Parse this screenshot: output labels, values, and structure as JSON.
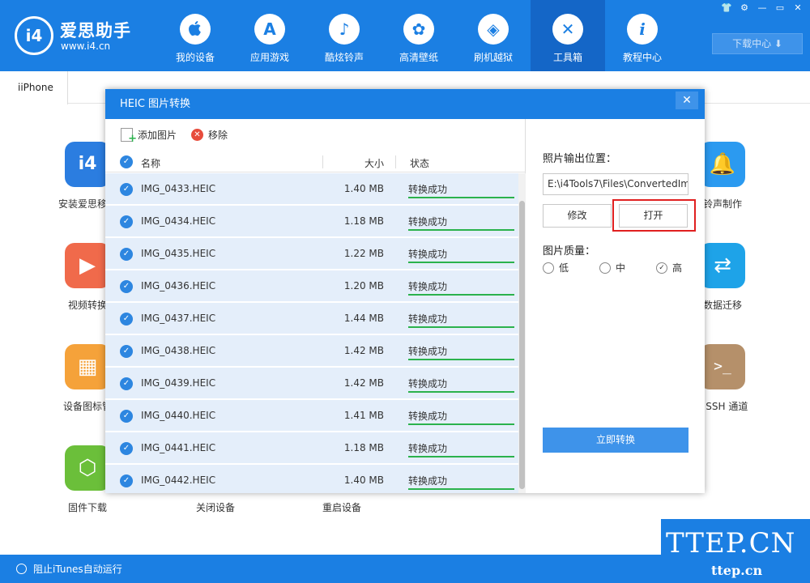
{
  "app": {
    "logo_badge": "i4",
    "name": "爱思助手",
    "url": "www.i4.cn"
  },
  "nav": [
    {
      "label": "我的设备",
      "icon": "apple-icon",
      "glyph": ""
    },
    {
      "label": "应用游戏",
      "icon": "app-store-icon",
      "glyph": "A"
    },
    {
      "label": "酷炫铃声",
      "icon": "bell-icon",
      "glyph": "♪"
    },
    {
      "label": "高清壁纸",
      "icon": "flower-icon",
      "glyph": "✿"
    },
    {
      "label": "刷机越狱",
      "icon": "dropbox-icon",
      "glyph": "◈"
    },
    {
      "label": "工具箱",
      "icon": "tools-icon",
      "glyph": "✕"
    },
    {
      "label": "教程中心",
      "icon": "info-icon",
      "glyph": "i"
    }
  ],
  "window_controls": [
    "👕",
    "⚙",
    "—",
    "▭",
    "✕"
  ],
  "download_center": "下载中心 ⬇",
  "device_tab": "iiPhone",
  "tools": [
    {
      "label": "安装爱思移动",
      "icon": "i4-app-icon",
      "glyph": "i4",
      "color": "#2b7de0"
    },
    {
      "label": "铃声制作",
      "icon": "bell-plus-icon",
      "glyph": "🔔",
      "color": "#2b9af0"
    },
    {
      "label": "视频转换",
      "icon": "video-convert-icon",
      "glyph": "▶",
      "color": "#f06a4b"
    },
    {
      "label": "数据迁移",
      "icon": "data-migrate-icon",
      "glyph": "⇄",
      "color": "#1ea3e8"
    },
    {
      "label": "设备图标管",
      "icon": "icon-manage-icon",
      "glyph": "▦",
      "color": "#f5a23a"
    },
    {
      "label": "F SSH 通道",
      "icon": "ssh-terminal-icon",
      "glyph": ">_",
      "color": "#b5906a"
    },
    {
      "label": "固件下载",
      "icon": "firmware-box-icon",
      "glyph": "⬡",
      "color": "#6bbf3a"
    },
    {
      "label": "关闭设备",
      "icon": "",
      "glyph": "",
      "color": ""
    },
    {
      "label": "重启设备",
      "icon": "",
      "glyph": "",
      "color": ""
    }
  ],
  "bottom": {
    "itunes_toggle": "阻止iTunes自动运行"
  },
  "watermark": {
    "big": "TTEP.CN",
    "small": "ttep.cn"
  },
  "dialog": {
    "title": "HEIC 图片转换",
    "close": "✕",
    "toolbar": {
      "add": "添加图片",
      "remove": "移除"
    },
    "columns": {
      "name": "名称",
      "size": "大小",
      "status": "状态"
    },
    "files": [
      {
        "name": "IMG_0433.HEIC",
        "size": "1.40 MB",
        "status": "转换成功",
        "progress": 1.0
      },
      {
        "name": "IMG_0434.HEIC",
        "size": "1.18 MB",
        "status": "转换成功",
        "progress": 1.0
      },
      {
        "name": "IMG_0435.HEIC",
        "size": "1.22 MB",
        "status": "转换成功",
        "progress": 1.0
      },
      {
        "name": "IMG_0436.HEIC",
        "size": "1.20 MB",
        "status": "转换成功",
        "progress": 1.0
      },
      {
        "name": "IMG_0437.HEIC",
        "size": "1.44 MB",
        "status": "转换成功",
        "progress": 1.0
      },
      {
        "name": "IMG_0438.HEIC",
        "size": "1.42 MB",
        "status": "转换成功",
        "progress": 1.0
      },
      {
        "name": "IMG_0439.HEIC",
        "size": "1.42 MB",
        "status": "转换成功",
        "progress": 1.0
      },
      {
        "name": "IMG_0440.HEIC",
        "size": "1.41 MB",
        "status": "转换成功",
        "progress": 1.0
      },
      {
        "name": "IMG_0441.HEIC",
        "size": "1.18 MB",
        "status": "转换成功",
        "progress": 1.0
      },
      {
        "name": "IMG_0442.HEIC",
        "size": "1.40 MB",
        "status": "转换成功",
        "progress": 1.0
      }
    ],
    "output_label": "照片输出位置：",
    "output_path": "E:\\i4Tools7\\Files\\ConvertedIm",
    "edit_button": "修改",
    "open_button": "打开",
    "quality_label": "图片质量：",
    "quality_options": [
      {
        "label": "低",
        "selected": false
      },
      {
        "label": "中",
        "selected": false
      },
      {
        "label": "高",
        "selected": true
      }
    ],
    "convert_button": "立即转换"
  },
  "colors": {
    "brand": "#1b7fe3",
    "status_ok": "#2bb24c",
    "highlight": "#e02020",
    "row_bg": "#e4eefa"
  }
}
